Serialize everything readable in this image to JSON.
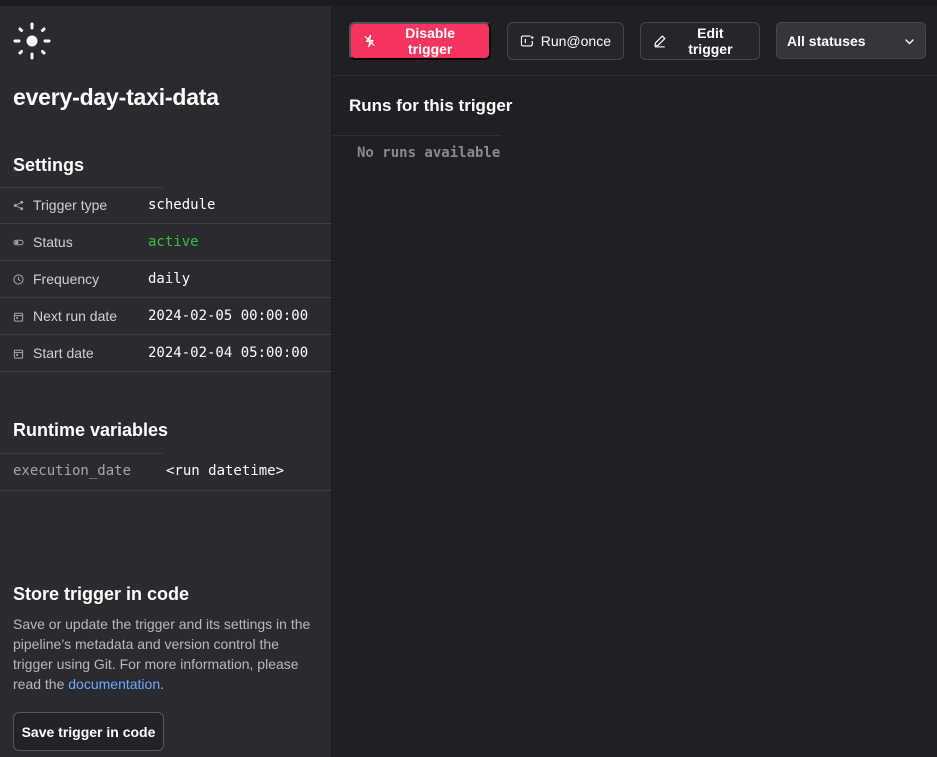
{
  "trigger": {
    "name": "every-day-taxi-data"
  },
  "settings": {
    "title": "Settings",
    "rows": [
      {
        "label": "Trigger type",
        "value": "schedule",
        "icon": "share-icon"
      },
      {
        "label": "Status",
        "value": "active",
        "icon": "toggle-icon",
        "value_color": "#38c038"
      },
      {
        "label": "Frequency",
        "value": "daily",
        "icon": "clock-icon"
      },
      {
        "label": "Next run date",
        "value": "2024-02-05 00:00:00",
        "icon": "calendar-icon"
      },
      {
        "label": "Start date",
        "value": "2024-02-04 05:00:00",
        "icon": "calendar-icon"
      }
    ]
  },
  "runtime": {
    "title": "Runtime variables",
    "variables": [
      {
        "key": "execution_date",
        "value": "<run datetime>"
      }
    ]
  },
  "store": {
    "title": "Store trigger in code",
    "description": "Save or update the trigger and its settings in the pipeline’s metadata and version control the trigger using Git. For more information, please read the ",
    "link_text": "documentation",
    "suffix": ".",
    "button_label": "Save trigger in code"
  },
  "toolbar": {
    "disable_label": "Disable trigger",
    "run_once_label": "Run@once",
    "edit_label": "Edit trigger",
    "status_filter": "All statuses",
    "accent_color": "#f5345f"
  },
  "runs": {
    "title": "Runs for this trigger",
    "empty_text": "No runs available"
  }
}
